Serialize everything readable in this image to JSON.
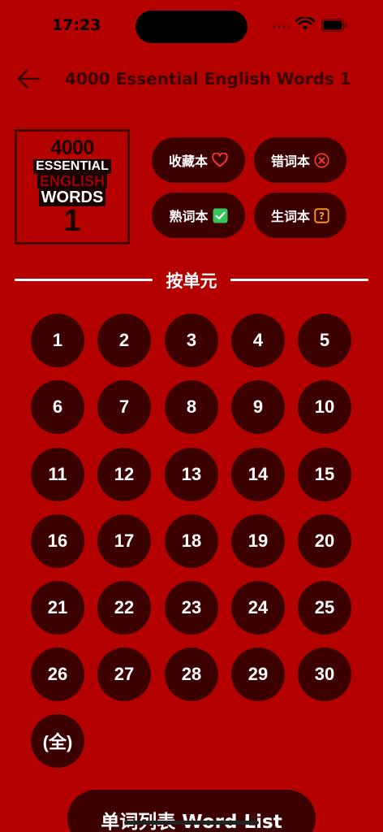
{
  "status_bar": {
    "time": "17:23"
  },
  "header": {
    "title": "4000 Essential English Words 1"
  },
  "cover": {
    "line1": "4000",
    "line2": "ESSENTIAL",
    "line3": "ENGLISH",
    "line4": "WORDS",
    "line5": "1"
  },
  "buttons": {
    "favorites": "收藏本",
    "mistakes": "错词本",
    "familiar": "熟词本",
    "unfamiliar": "生词本"
  },
  "section": {
    "label": "按单元"
  },
  "units": [
    "1",
    "2",
    "3",
    "4",
    "5",
    "6",
    "7",
    "8",
    "9",
    "10",
    "11",
    "12",
    "13",
    "14",
    "15",
    "16",
    "17",
    "18",
    "19",
    "20",
    "21",
    "22",
    "23",
    "24",
    "25",
    "26",
    "27",
    "28",
    "29",
    "30",
    "(全)"
  ],
  "word_list_button": "单词列表 Word List",
  "colors": {
    "background": "#b50000",
    "button": "#3d0000",
    "check": "#34c759",
    "question": "#ff9f0a"
  }
}
